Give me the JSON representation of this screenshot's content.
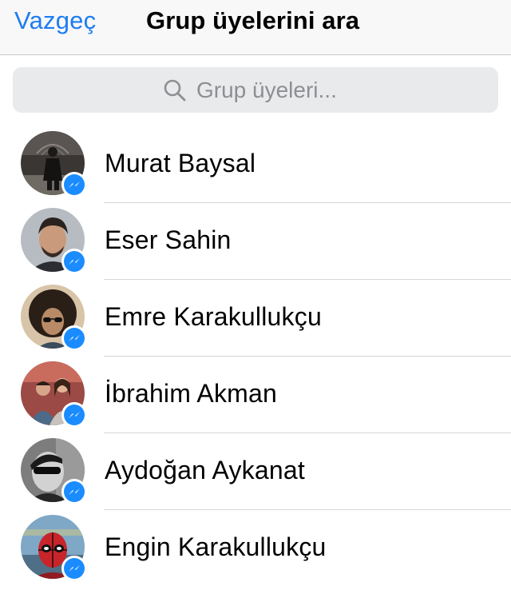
{
  "header": {
    "cancel_label": "Vazgeç",
    "title": "Grup üyelerini ara"
  },
  "search": {
    "placeholder": "Grup üyeleri...",
    "value": ""
  },
  "colors": {
    "accent": "#1d7cf2",
    "messenger_badge": "#1a8cff",
    "search_background": "#e9eaec"
  },
  "members": [
    {
      "name": "Murat Baysal",
      "avatar_icon": "person-photo",
      "badge_icon": "messenger-badge-icon"
    },
    {
      "name": "Eser Sahin",
      "avatar_icon": "person-photo",
      "badge_icon": "messenger-badge-icon"
    },
    {
      "name": "Emre Karakullukçu",
      "avatar_icon": "person-photo",
      "badge_icon": "messenger-badge-icon"
    },
    {
      "name": "İbrahim Akman",
      "avatar_icon": "person-photo",
      "badge_icon": "messenger-badge-icon"
    },
    {
      "name": "Aydoğan Aykanat",
      "avatar_icon": "person-photo",
      "badge_icon": "messenger-badge-icon"
    },
    {
      "name": "Engin Karakullukçu",
      "avatar_icon": "person-photo",
      "badge_icon": "messenger-badge-icon"
    }
  ]
}
